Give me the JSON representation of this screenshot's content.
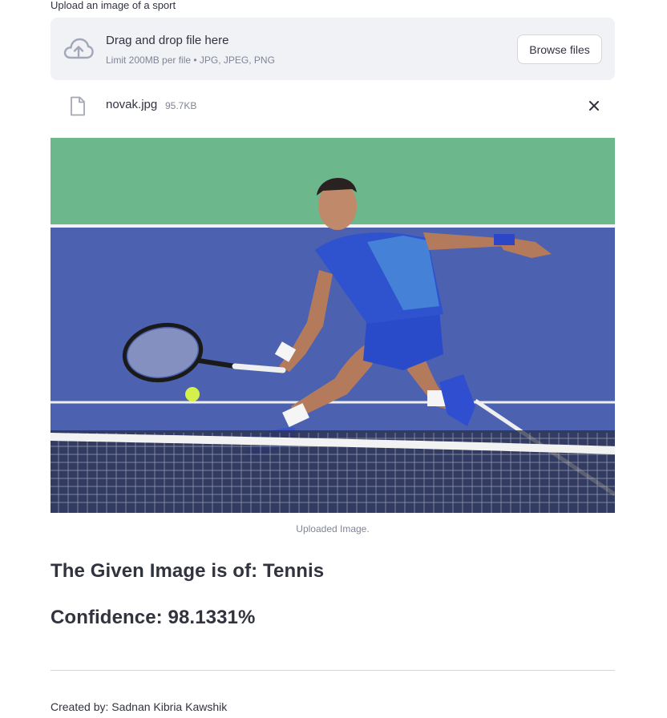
{
  "uploader": {
    "label": "Upload an image of a sport",
    "drop_title": "Drag and drop file here",
    "drop_limit": "Limit 200MB per file • JPG, JPEG, PNG",
    "browse_label": "Browse files"
  },
  "file": {
    "name": "novak.jpg",
    "size": "95.7KB"
  },
  "image": {
    "caption": "Uploaded Image."
  },
  "result": {
    "prediction": "The Given Image is of: Tennis",
    "confidence": "Confidence: 98.1331%"
  },
  "footer": {
    "credit": "Created by: Sadnan Kibria Kawshik"
  },
  "colors": {
    "text": "#31333f",
    "muted": "#808495",
    "dropzone_bg": "#f0f2f6",
    "court_blue": "#4c61b0",
    "court_green": "#6cb88c"
  }
}
